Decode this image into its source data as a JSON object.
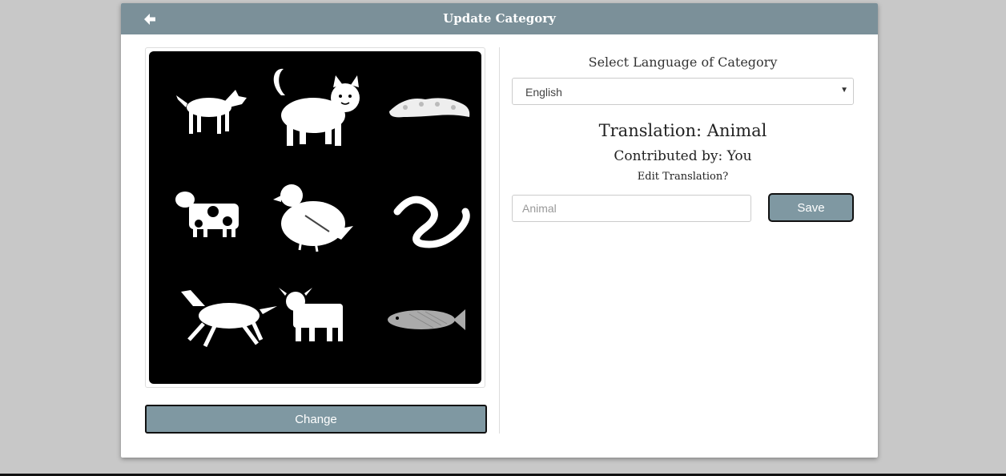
{
  "header": {
    "title": "Update Category",
    "back_icon": "arrow-left-icon"
  },
  "category_image": {
    "animals": [
      "dog",
      "cat",
      "caterpillar",
      "cow",
      "pigeon",
      "snake",
      "horse",
      "bull",
      "fish"
    ],
    "background": "#000000"
  },
  "left": {
    "change_label": "Change"
  },
  "right": {
    "language_label": "Select Language of Category",
    "language_selected": "English",
    "translation_text": "Translation: Animal",
    "contributed_text": "Contributed by: You",
    "edit_text": "Edit Translation?",
    "input_placeholder": "Animal",
    "input_value": "",
    "save_label": "Save"
  },
  "colors": {
    "header_bg": "#7b9099",
    "button_bg": "#7f98a2",
    "page_bg": "#c8c8c8"
  }
}
